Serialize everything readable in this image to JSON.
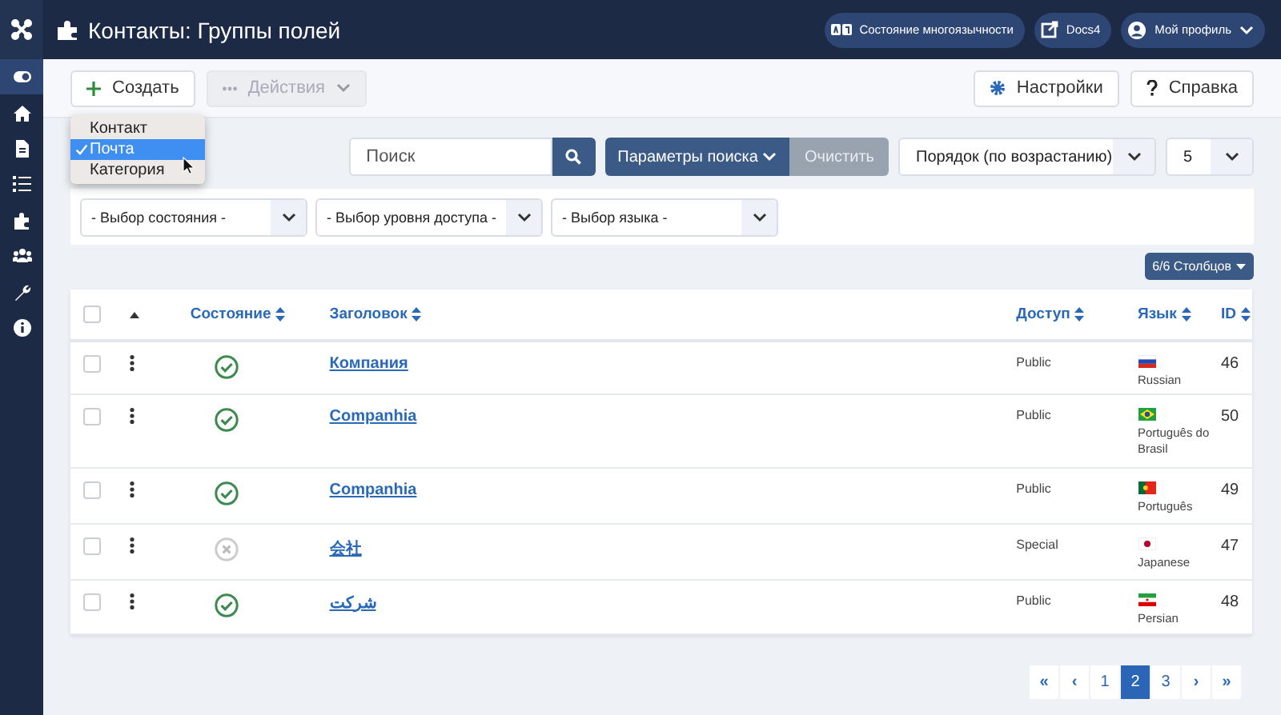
{
  "header": {
    "title": "Контакты: Группы полей",
    "buttons": [
      {
        "kind": "language",
        "label": "Состояние многоязычности"
      },
      {
        "kind": "external",
        "label": "Docs4"
      },
      {
        "kind": "profile",
        "label": "Мой профиль"
      }
    ]
  },
  "sidebar": {
    "items": [
      {
        "kind": "toggle",
        "selected": true
      },
      {
        "kind": "home",
        "selected": false
      },
      {
        "kind": "file",
        "selected": false
      },
      {
        "kind": "list",
        "selected": false
      },
      {
        "kind": "puzzle",
        "selected": false
      },
      {
        "kind": "users",
        "selected": false
      },
      {
        "kind": "wrench",
        "selected": false
      },
      {
        "kind": "info",
        "selected": false
      }
    ]
  },
  "toolbar": {
    "create": "Создать",
    "actions": {
      "label": "Действия",
      "disabled": true
    },
    "options": "Настройки",
    "help": "Справка"
  },
  "context_menu": [
    {
      "label": "Контакт",
      "selected": false
    },
    {
      "label": "Почта",
      "selected": true
    },
    {
      "label": "Категория",
      "selected": false
    }
  ],
  "search": {
    "placeholder": "Поиск",
    "filter_options": "Параметры поиска",
    "clear": "Очистить",
    "ordering": "Порядок (по возрастанию)",
    "limit": "5"
  },
  "filters": [
    {
      "placeholder": "- Выбор состояния -"
    },
    {
      "placeholder": "- Выбор уровня доступа -"
    },
    {
      "placeholder": "- Выбор языка -"
    }
  ],
  "columns_button": "6/6 Столбцов",
  "table": {
    "all_checked": false,
    "columns": [
      "Состояние",
      "Заголовок",
      "Доступ",
      "Язык",
      "ID"
    ],
    "rows": [
      {
        "checked": false,
        "published": true,
        "title": "Компания",
        "access": "Public",
        "language": {
          "name": "Russian",
          "kind": "ru"
        },
        "id": "46"
      },
      {
        "checked": false,
        "published": true,
        "title": "Companhia",
        "access": "Public",
        "language": {
          "name": "Português do Brasil",
          "kind": "br"
        },
        "id": "50"
      },
      {
        "checked": false,
        "published": true,
        "title": "Companhia",
        "access": "Public",
        "language": {
          "name": "Português",
          "kind": "pt"
        },
        "id": "49"
      },
      {
        "checked": false,
        "published": false,
        "title": "会社",
        "access": "Special",
        "language": {
          "name": "Japanese",
          "kind": "jp"
        },
        "id": "47"
      },
      {
        "checked": false,
        "published": true,
        "title": "شركت",
        "access": "Public",
        "language": {
          "name": "Persian",
          "kind": "ir"
        },
        "id": "48"
      }
    ]
  },
  "pagination": [
    {
      "kind": "first",
      "label": "«",
      "selected": false
    },
    {
      "kind": "prev",
      "label": "‹",
      "selected": false
    },
    {
      "kind": "page",
      "label": "1",
      "selected": false
    },
    {
      "kind": "page",
      "label": "2",
      "selected": true
    },
    {
      "kind": "page",
      "label": "3",
      "selected": false
    },
    {
      "kind": "next",
      "label": "›",
      "selected": false
    },
    {
      "kind": "last",
      "label": "»",
      "selected": false
    }
  ]
}
